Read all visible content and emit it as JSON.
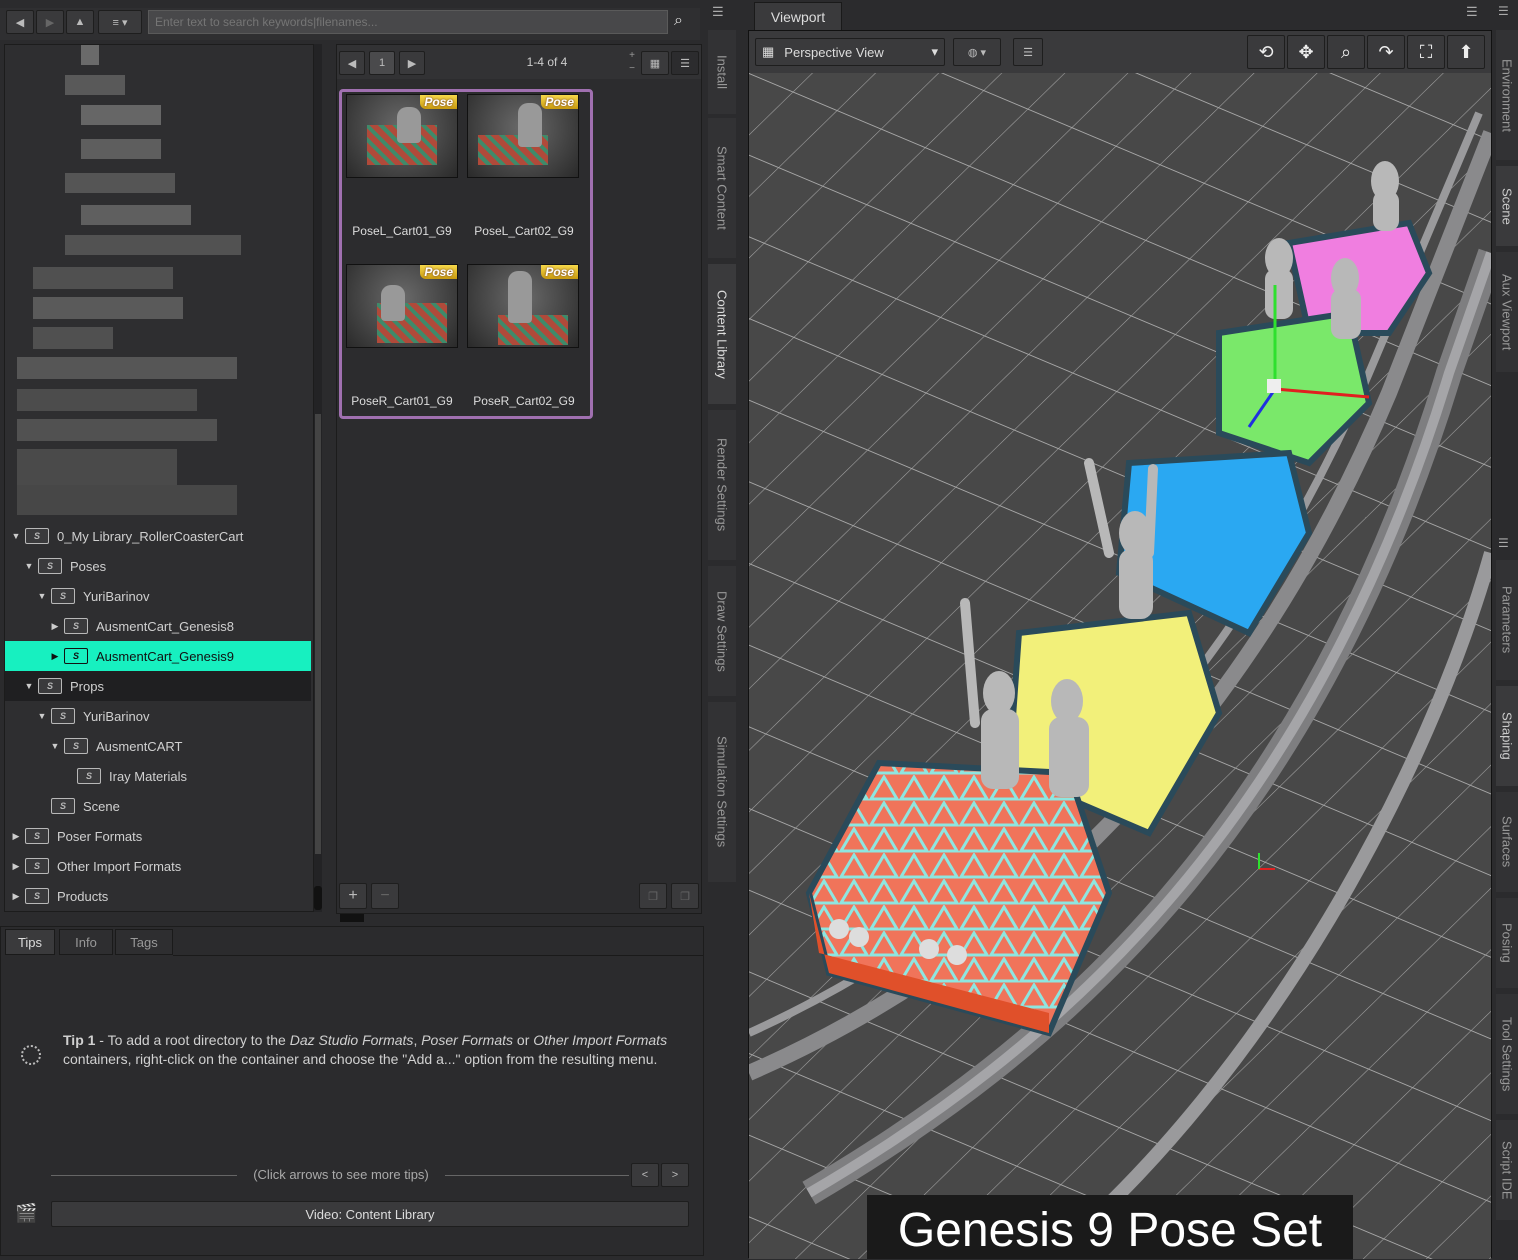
{
  "search": {
    "placeholder": "Enter text to search keywords|filenames..."
  },
  "tree": {
    "items": [
      {
        "label": "0_My Library_RollerCoasterCart",
        "indent": 0,
        "expanded": true
      },
      {
        "label": "Poses",
        "indent": 1,
        "expanded": true
      },
      {
        "label": "YuriBarinov",
        "indent": 2,
        "expanded": true
      },
      {
        "label": "AusmentCart_Genesis8",
        "indent": 3,
        "expanded": false
      },
      {
        "label": "AusmentCart_Genesis9",
        "indent": 3,
        "expanded": false,
        "selected": true
      },
      {
        "label": "Props",
        "indent": 1,
        "expanded": true
      },
      {
        "label": "YuriBarinov",
        "indent": 2,
        "expanded": true
      },
      {
        "label": "AusmentCART",
        "indent": 3,
        "expanded": true
      },
      {
        "label": "Iray Materials",
        "indent": 4
      },
      {
        "label": "Scene",
        "indent": 2
      },
      {
        "label": "Poser Formats",
        "indent": 0
      },
      {
        "label": "Other Import Formats",
        "indent": 0
      },
      {
        "label": "Products",
        "indent": 0
      }
    ]
  },
  "content": {
    "page": "1",
    "count_label": "1-4 of 4",
    "items": [
      {
        "label": "PoseL_Cart01_G9",
        "badge": "Pose"
      },
      {
        "label": "PoseL_Cart02_G9",
        "badge": "Pose"
      },
      {
        "label": "PoseR_Cart01_G9",
        "badge": "Pose"
      },
      {
        "label": "PoseR_Cart02_G9",
        "badge": "Pose"
      }
    ],
    "add_label": "+",
    "remove_label": "−"
  },
  "side_tabs_left": [
    "Install",
    "Smart Content",
    "Content Library",
    "Render Settings",
    "Draw Settings",
    "Simulation Settings"
  ],
  "side_tabs_right": [
    "Environment",
    "Scene",
    "Aux Viewport",
    "Parameters",
    "Shaping",
    "Surfaces",
    "Posing",
    "Tool Settings",
    "Script IDE"
  ],
  "tips": {
    "tabs": [
      "Tips",
      "Info",
      "Tags"
    ],
    "tip_title": "Tip 1",
    "tip_text_1": " - To add a root directory to the ",
    "tip_em_1": "Daz Studio Formats",
    "tip_text_2": ", ",
    "tip_em_2": "Poser Formats",
    "tip_text_3": " or ",
    "tip_em_3": "Other Import Formats",
    "tip_text_4": " containers, right-click on the container and choose the \"Add a...\" option from the resulting menu.",
    "more_tips": "(Click arrows to see more tips)",
    "prev": "<",
    "next": ">",
    "video_label": "Video: Content Library"
  },
  "viewport": {
    "tab": "Viewport",
    "view_label": "Perspective View",
    "caption": "Genesis 9 Pose Set",
    "cart_colors": [
      "#e8684a",
      "#f2f07a",
      "#2aa8f2",
      "#7ae86a",
      "#f07ee0"
    ]
  }
}
